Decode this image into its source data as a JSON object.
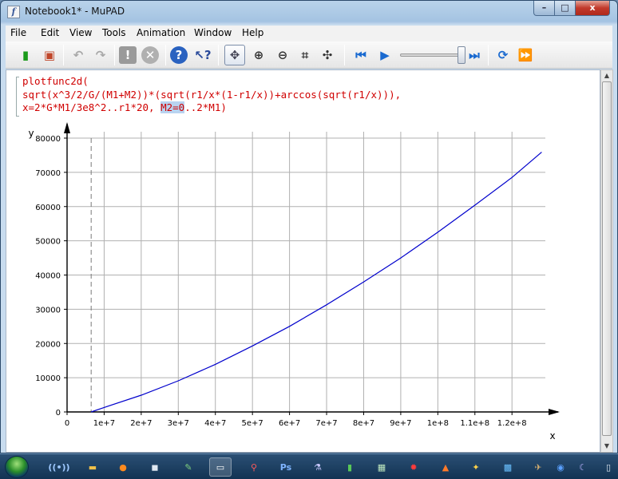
{
  "window": {
    "app_icon_glyph": "f",
    "title": "Notebook1* - MuPAD",
    "controls": {
      "minimize": "–",
      "maximize": "□",
      "close": "x"
    }
  },
  "menubar": [
    "File",
    "Edit",
    "View",
    "Tools",
    "Animation",
    "Window",
    "Help"
  ],
  "toolbar": {
    "icons": [
      "evaluate-icon",
      "slide-icon",
      "undo-icon",
      "redo-icon",
      "stop-icon",
      "cancel-icon",
      "help-icon",
      "context-help-icon",
      "pointer-icon",
      "zoom-in-icon",
      "zoom-out-icon",
      "crop-icon",
      "move-icon",
      "rewind-icon",
      "play-icon",
      "slider",
      "end-icon",
      "refresh-icon",
      "fast-forward-icon"
    ],
    "animation_progress": 1.0
  },
  "input": {
    "line1": "plotfunc2d(",
    "line2": "sqrt(x^3/2/G/(M1+M2))*(sqrt(r1/x*(1-r1/x))+arccos(sqrt(r1/x))),",
    "line3_prefix": "x=2*G*M1/3e8^2..r1*20, ",
    "line3_highlight": "M2=0",
    "line3_suffix": "..2*M1)"
  },
  "chart_data": {
    "type": "line",
    "xlabel": "x",
    "ylabel": "y",
    "xlim": [
      0,
      129000000
    ],
    "ylim": [
      0,
      80000
    ],
    "x_ticks": [
      0,
      10000000,
      20000000,
      30000000,
      40000000,
      50000000,
      60000000,
      70000000,
      80000000,
      90000000,
      100000000,
      110000000,
      120000000
    ],
    "x_tick_labels": [
      "0",
      "1e+7",
      "2e+7",
      "3e+7",
      "4e+7",
      "5e+7",
      "6e+7",
      "7e+7",
      "8e+7",
      "9e+7",
      "1e+8",
      "1.1e+8",
      "1.2e+8"
    ],
    "y_ticks": [
      0,
      10000,
      20000,
      30000,
      40000,
      50000,
      60000,
      70000,
      80000
    ],
    "y_tick_labels": [
      "0",
      "10000",
      "20000",
      "30000",
      "40000",
      "50000",
      "60000",
      "70000",
      "80000"
    ],
    "grid": true,
    "asymptote_x": 6500000,
    "series": [
      {
        "color": "#0000cc",
        "x": [
          6500000,
          10000000,
          20000000,
          30000000,
          40000000,
          50000000,
          60000000,
          70000000,
          80000000,
          90000000,
          100000000,
          110000000,
          120000000,
          128000000
        ],
        "y": [
          0,
          1300,
          4900,
          9100,
          13900,
          19300,
          25000,
          31300,
          38000,
          45000,
          52500,
          60400,
          68500,
          75900
        ]
      }
    ]
  },
  "taskbar": {
    "start_label": "Start",
    "items": [
      {
        "icon": "network-icon",
        "glyph": "((•))",
        "color": "#9ec8ff"
      },
      {
        "icon": "folder-icon",
        "glyph": "▬",
        "color": "#f0c04a"
      },
      {
        "icon": "firefox-icon",
        "glyph": "●",
        "color": "#ff8a1e"
      },
      {
        "icon": "app-window-icon",
        "glyph": "◼",
        "color": "#dfe8f2"
      },
      {
        "icon": "app-paint-icon",
        "glyph": "✎",
        "color": "#7fd07f"
      },
      {
        "icon": "app-screen-icon",
        "glyph": "▭",
        "color": "#ffffff"
      },
      {
        "icon": "app-red-tool-icon",
        "glyph": "⚲",
        "color": "#ff5a5a"
      },
      {
        "icon": "photoshop-icon",
        "glyph": "Ps",
        "color": "#7fb4ff"
      },
      {
        "icon": "flask-icon",
        "glyph": "⚗",
        "color": "#c8c8ff"
      },
      {
        "icon": "chart-app-icon",
        "glyph": "▮",
        "color": "#58c858"
      },
      {
        "icon": "spreadsheet-icon",
        "glyph": "▦",
        "color": "#bfe8bf"
      },
      {
        "icon": "gear-red-icon",
        "glyph": "✹",
        "color": "#ff3b3b"
      },
      {
        "icon": "matlab-icon",
        "glyph": "▲",
        "color": "#ff7a2a"
      },
      {
        "icon": "mupad-icon",
        "glyph": "✦",
        "color": "#ffd24a"
      },
      {
        "icon": "grid-app-icon",
        "glyph": "▩",
        "color": "#6ac0ff"
      },
      {
        "icon": "satellite-icon",
        "glyph": "✈",
        "color": "#d8b070"
      },
      {
        "icon": "globe-icon",
        "glyph": "◉",
        "color": "#5aa0ff"
      },
      {
        "icon": "night-sky-icon",
        "glyph": "☾",
        "color": "#b8b0ff"
      },
      {
        "icon": "show-desktop-icon",
        "glyph": "▯",
        "color": "#dfe8f2"
      }
    ]
  }
}
